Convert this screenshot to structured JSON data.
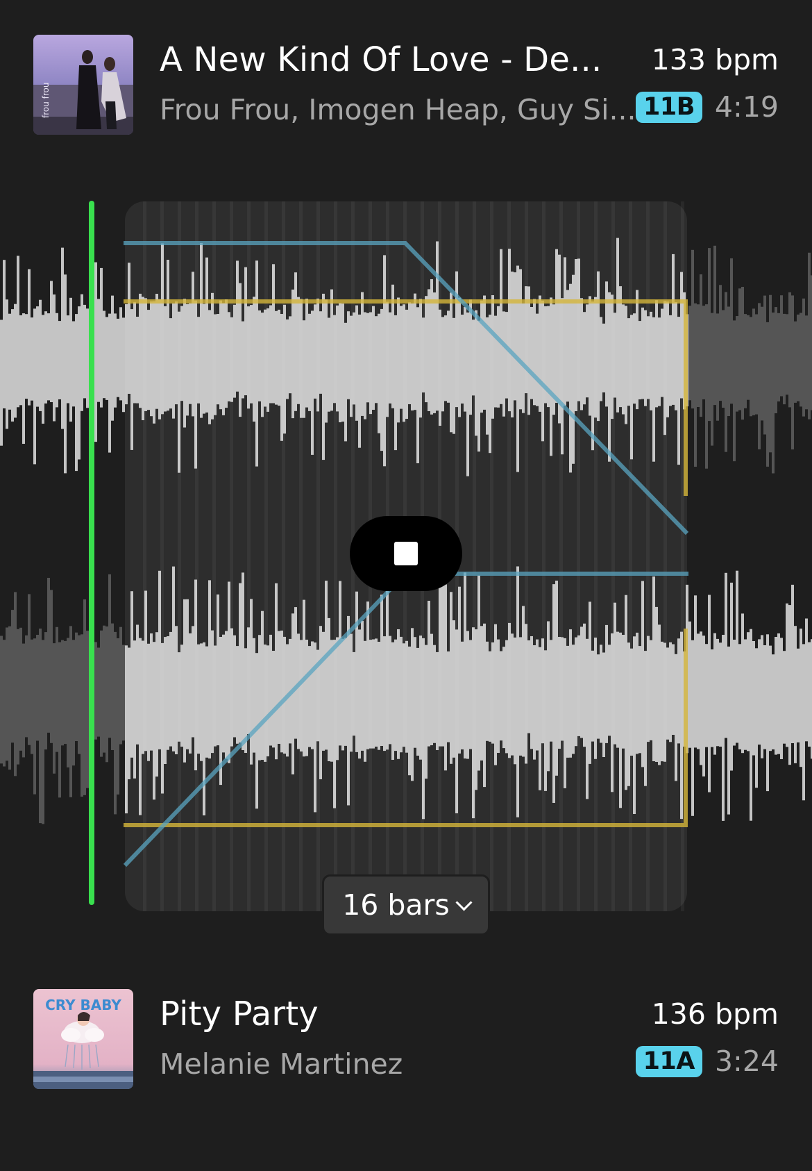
{
  "outgoing_track": {
    "title": "A New Kind Of Love - De...",
    "artist": "Frou Frou, Imogen Heap, Guy Si...",
    "bpm": "133 bpm",
    "key": "11B",
    "duration": "4:19",
    "artwork_text": "frou frou"
  },
  "transition": {
    "length_label": "16 bars",
    "playing": true,
    "accent_colors": {
      "playhead": "#39e04e",
      "volume_curve": "#d4b53a",
      "eq_curve": "#5aa4c0",
      "key_badge": "#59d2ec"
    }
  },
  "incoming_track": {
    "title": "Pity Party",
    "artist": "Melanie Martinez",
    "bpm": "136 bpm",
    "key": "11A",
    "duration": "3:24",
    "artwork_text": "CRY BABY"
  }
}
